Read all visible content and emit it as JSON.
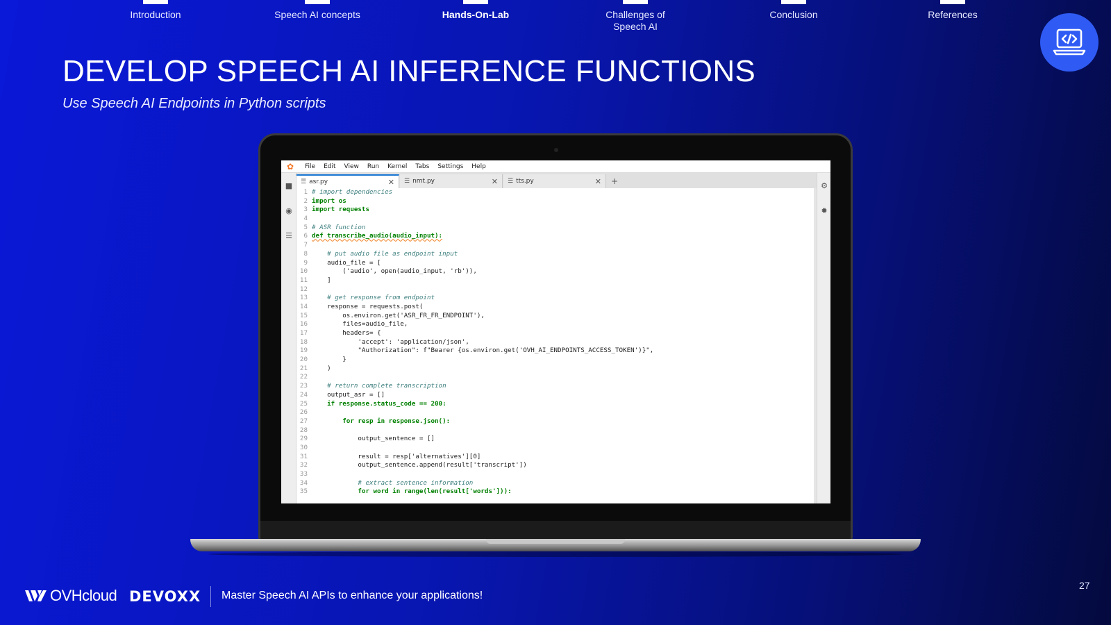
{
  "nav": {
    "items": [
      {
        "label": "Introduction",
        "active": false
      },
      {
        "label": "Speech AI concepts",
        "active": false
      },
      {
        "label": "Hands-On-Lab",
        "active": true
      },
      {
        "label": "Challenges of Speech AI",
        "active": false
      },
      {
        "label": "Conclusion",
        "active": false
      },
      {
        "label": "References",
        "active": false
      }
    ]
  },
  "badge": {
    "icon": "laptop-code-icon",
    "color": "#2f5bf4"
  },
  "slide": {
    "title": "DEVELOP SPEECH AI INFERENCE FUNCTIONS",
    "subtitle": "Use Speech AI Endpoints in Python scripts"
  },
  "ide": {
    "menu": [
      "File",
      "Edit",
      "View",
      "Run",
      "Kernel",
      "Tabs",
      "Settings",
      "Help"
    ],
    "tabs": [
      {
        "label": "asr.py",
        "active": true
      },
      {
        "label": "nmt.py",
        "active": false
      },
      {
        "label": "tts.py",
        "active": false
      }
    ],
    "code": [
      {
        "n": "1",
        "text": "# import dependencies"
      },
      {
        "n": "2",
        "text": "import os"
      },
      {
        "n": "3",
        "text": "import requests"
      },
      {
        "n": "4",
        "text": ""
      },
      {
        "n": "5",
        "text": "# ASR function"
      },
      {
        "n": "6",
        "text": "def transcribe_audio(audio_input):"
      },
      {
        "n": "7",
        "text": ""
      },
      {
        "n": "8",
        "text": "    # put audio file as endpoint input"
      },
      {
        "n": "9",
        "text": "    audio_file = ["
      },
      {
        "n": "10",
        "text": "        ('audio', open(audio_input, 'rb')),"
      },
      {
        "n": "11",
        "text": "    ]"
      },
      {
        "n": "12",
        "text": ""
      },
      {
        "n": "13",
        "text": "    # get response from endpoint"
      },
      {
        "n": "14",
        "text": "    response = requests.post("
      },
      {
        "n": "15",
        "text": "        os.environ.get('ASR_FR_FR_ENDPOINT'),"
      },
      {
        "n": "16",
        "text": "        files=audio_file,"
      },
      {
        "n": "17",
        "text": "        headers= {"
      },
      {
        "n": "18",
        "text": "            'accept': 'application/json',"
      },
      {
        "n": "19",
        "text": "            \"Authorization\": f\"Bearer {os.environ.get('OVH_AI_ENDPOINTS_ACCESS_TOKEN')}\","
      },
      {
        "n": "20",
        "text": "        }"
      },
      {
        "n": "21",
        "text": "    )"
      },
      {
        "n": "22",
        "text": ""
      },
      {
        "n": "23",
        "text": "    # return complete transcription"
      },
      {
        "n": "24",
        "text": "    output_asr = []"
      },
      {
        "n": "25",
        "text": "    if response.status_code == 200:"
      },
      {
        "n": "26",
        "text": ""
      },
      {
        "n": "27",
        "text": "        for resp in response.json():"
      },
      {
        "n": "28",
        "text": ""
      },
      {
        "n": "29",
        "text": "            output_sentence = []"
      },
      {
        "n": "30",
        "text": ""
      },
      {
        "n": "31",
        "text": "            result = resp['alternatives'][0]"
      },
      {
        "n": "32",
        "text": "            output_sentence.append(result['transcript'])"
      },
      {
        "n": "33",
        "text": ""
      },
      {
        "n": "34",
        "text": "            # extract sentence information"
      },
      {
        "n": "35",
        "text": "            for word in range(len(result['words'])):"
      }
    ]
  },
  "footer": {
    "brand1": "OVHcloud",
    "brand2": "DEVOXX",
    "tagline": "Master Speech AI APIs to enhance your applications!",
    "page": "27"
  }
}
